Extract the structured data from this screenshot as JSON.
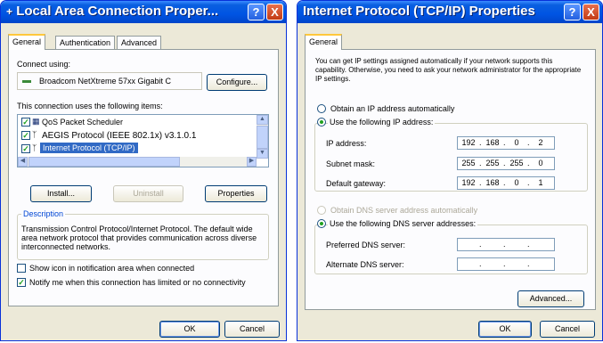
{
  "left_window": {
    "title": "Local Area Connection Proper...",
    "title_icon": "network-icon",
    "help": "?",
    "close": "X",
    "tabs": [
      "General",
      "Authentication",
      "Advanced"
    ],
    "connect_using_label": "Connect using:",
    "adapter_name": "Broadcom NetXtreme 57xx Gigabit C",
    "configure": "Configure...",
    "items_label": "This connection uses the following items:",
    "items": [
      {
        "label": "QoS Packet Scheduler",
        "checked": true
      },
      {
        "label": "AEGIS Protocol (IEEE 802.1x) v3.1.0.1",
        "checked": true
      },
      {
        "label": "Internet Protocol (TCP/IP)",
        "checked": true,
        "selected": true
      }
    ],
    "install": "Install...",
    "uninstall": "Uninstall",
    "properties": "Properties",
    "description_title": "Description",
    "description_text": "Transmission Control Protocol/Internet Protocol. The default wide area network protocol that provides communication across diverse interconnected networks.",
    "show_icon": "Show icon in notification area when connected",
    "notify": "Notify me when this connection has limited or no connectivity",
    "show_icon_checked": false,
    "notify_checked": true,
    "ok": "OK",
    "cancel": "Cancel",
    "colors": {
      "titlebar": "#0054e3",
      "selection": "#316ac5"
    }
  },
  "right_window": {
    "title": "Internet Protocol (TCP/IP) Properties",
    "help": "?",
    "close": "X",
    "tab": "General",
    "intro": "You can get IP settings assigned automatically if your network supports this capability. Otherwise, you need to ask your network administrator for the appropriate IP settings.",
    "obtain_ip": "Obtain an IP address automatically",
    "use_ip": "Use the following IP address:",
    "ip_label": "IP address:",
    "ip": [
      "192",
      "168",
      "0",
      "2"
    ],
    "mask_label": "Subnet mask:",
    "mask": [
      "255",
      "255",
      "255",
      "0"
    ],
    "gateway_label": "Default gateway:",
    "gateway": [
      "192",
      "168",
      "0",
      "1"
    ],
    "obtain_dns": "Obtain DNS server address automatically",
    "use_dns": "Use the following DNS server addresses:",
    "pref_dns_label": "Preferred DNS server:",
    "alt_dns_label": "Alternate DNS server:",
    "advanced": "Advanced...",
    "ok": "OK",
    "cancel": "Cancel"
  }
}
